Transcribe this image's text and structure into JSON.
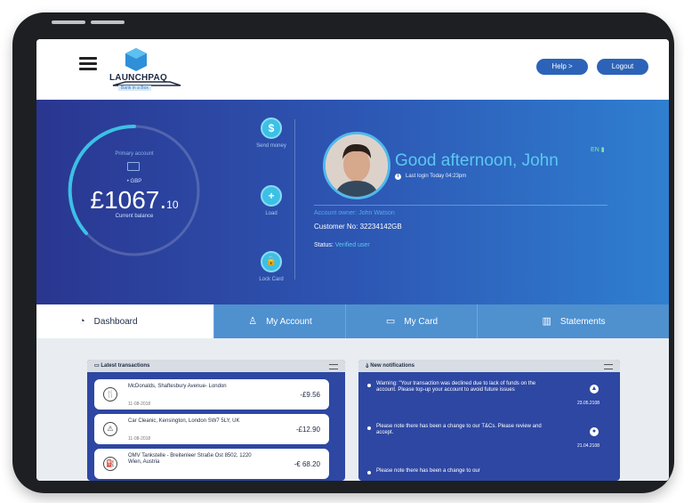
{
  "header": {
    "logo_text": "LAUNCHPAQ",
    "logo_tagline": "Bank in a Box",
    "help_label": "Help >",
    "logout_label": "Logout"
  },
  "balance": {
    "account_label": "Primary account",
    "currency": "• GBP",
    "amount_main": "£1067.",
    "amount_decimal": "10",
    "label": "Current balance"
  },
  "actions": {
    "send": {
      "icon": "send-money-icon",
      "glyph": "$",
      "label": "Send money"
    },
    "load": {
      "icon": "plus-icon",
      "glyph": "+",
      "label": "Load"
    },
    "lock": {
      "icon": "lock-icon",
      "glyph": "🔒",
      "label": "Lock Card"
    }
  },
  "profile": {
    "greeting": "Good afternoon, John",
    "last_login": "Last login Today 04:23pm",
    "language": "EN",
    "account_owner": "Account owner: John Watson",
    "customer_no": "Customer No: 32234142GB",
    "status_label": "Status:",
    "status_value": "Verified user"
  },
  "tabs": {
    "dashboard": "Dashboard",
    "my_account": "My Account",
    "my_card": "My Card",
    "statements": "Statements"
  },
  "transactions": {
    "title": "Latest transactions",
    "items": [
      {
        "title": "McDonalds, Shaftesbury Avenue- London",
        "date": "11-08-2018",
        "amount": "-£9.56",
        "icon": "restaurant-icon",
        "glyph": "🍴"
      },
      {
        "title": "Car Cleanic, Kensington, London SW7 5LY, UK",
        "date": "11-08-2018",
        "amount": "-£12.90",
        "icon": "car-wash-icon",
        "glyph": "⚠"
      },
      {
        "title": "OMV Tankstelle - Breitenleer Straße Ost 8502, 1220 Wien, Austria",
        "date": "",
        "amount": "-€ 68.20",
        "icon": "fuel-icon",
        "glyph": "⛽"
      }
    ]
  },
  "notifications": {
    "title": "New notifications",
    "items": [
      {
        "text": "Warning: \"Your transaction was declined due to lack of funds on the account. Please top-up your account to avoid future issues",
        "date": "23.05.2108",
        "glyph": "▲"
      },
      {
        "text": "Please note there has been a change to our T&Cs. Please review and accept.",
        "date": "21.04.2108",
        "glyph": "●"
      },
      {
        "text": "Please note there has been a change to our",
        "date": "",
        "glyph": ""
      }
    ]
  },
  "colors": {
    "hero_start": "#2a3690",
    "hero_end": "#2f7fd0",
    "accent_cyan": "#3cc0e6",
    "button_blue": "#2c63b8",
    "tab_blue": "#4f90cf",
    "panel_blue": "#2d47a3"
  }
}
